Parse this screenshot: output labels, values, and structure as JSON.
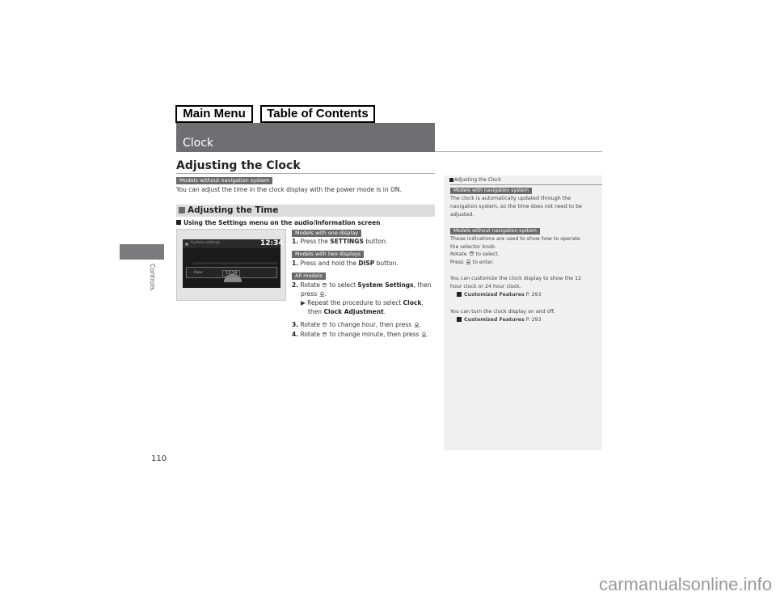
{
  "nav": {
    "main_menu": "Main Menu",
    "table_of_contents": "Table of Contents"
  },
  "chapter": {
    "title": "Clock",
    "side_label": "Controls",
    "page_number": "110"
  },
  "section": {
    "heading": "Adjusting the Clock",
    "badge": "Models without navigation system",
    "intro": "You can adjust the time in the clock display with the power mode is in ON.",
    "subsection_title": "Adjusting the Time",
    "subhead": "Using the Settings menu on the audio/information screen"
  },
  "screen_image": {
    "title": "System settings",
    "clock": "12:34",
    "row_label": "Hour",
    "row_value": "12:34"
  },
  "steps": {
    "badge_one_display": "Models with one display",
    "step1a": {
      "num": "1.",
      "pre": "Press the ",
      "bold": "SETTINGS",
      "post": " button."
    },
    "badge_two_displays": "Models with two displays",
    "step1b": {
      "num": "1.",
      "pre": "Press and hold the ",
      "bold": "DISP",
      "post": " button."
    },
    "badge_all": "All models",
    "step2": {
      "num": "2.",
      "pre": "Rotate",
      "mid": " to select ",
      "bold": "System Settings",
      "post": ", then",
      "line2": "press",
      "line2_end": "."
    },
    "step2_sub": {
      "arrow": "▶",
      "pre": "Repeat the procedure to select ",
      "bold1": "Clock",
      "post1": ",",
      "line2_pre": "then ",
      "bold2": "Clock Adjustment",
      "line2_post": "."
    },
    "step3": {
      "num": "3.",
      "pre": "Rotate",
      "mid": " to change hour, then press",
      "post": "."
    },
    "step4": {
      "num": "4.",
      "pre": "Rotate",
      "mid": " to change minute, then press",
      "post": "."
    }
  },
  "sidebar": {
    "header": "Adjusting the Clock",
    "badge_nav": "Models with navigation system",
    "nav_text_1": "The clock is automatically updated through the",
    "nav_text_2": "navigation system, so the time does not need to be",
    "nav_text_3": "adjusted.",
    "badge_no_nav": "Models without navigation system",
    "knob_text_1": "These indications are used to show how to operate",
    "knob_text_2": "the selector knob.",
    "rotate_pre": "Rotate",
    "rotate_post": " to select.",
    "press_pre": "Press",
    "press_post": " to enter.",
    "custom_text_1": "You can customize the clock display to show the 12",
    "custom_text_2": "hour clock or 24 hour clock.",
    "xref1_label": "Customized Features",
    "xref1_page": " P. 293",
    "onoff_text": "You can turn the clock display on and off.",
    "xref2_label": "Customized Features",
    "xref2_page": " P. 293"
  },
  "watermark": "carmanualsonline.info"
}
